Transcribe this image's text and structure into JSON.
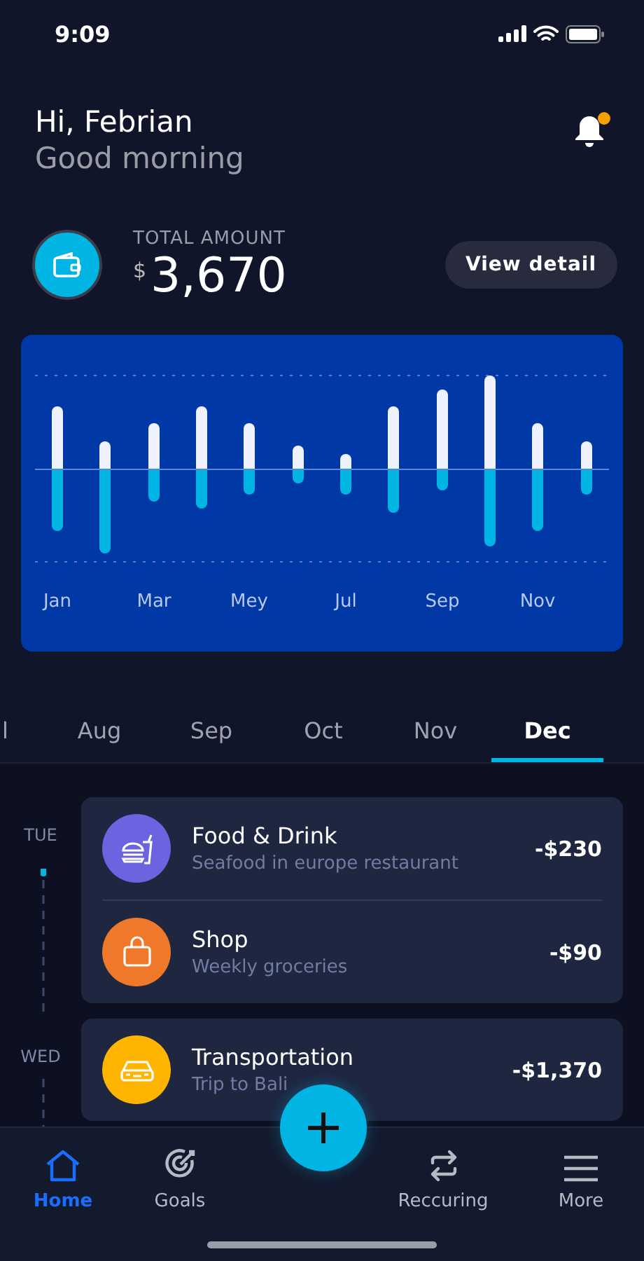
{
  "status_bar": {
    "time": "9:09"
  },
  "header": {
    "greeting": "Hi, Febrian",
    "subtitle": "Good morning",
    "notification_badge": true
  },
  "total": {
    "label": "TOTAL AMOUNT",
    "currency": "$",
    "amount": "3,670",
    "button": "View detail"
  },
  "chart": {
    "month_labels": [
      "Jan",
      "Mar",
      "Mey",
      "Jul",
      "Sep",
      "Nov"
    ]
  },
  "month_tabs": [
    {
      "label": "l",
      "selected": false
    },
    {
      "label": "Aug",
      "selected": false
    },
    {
      "label": "Sep",
      "selected": false
    },
    {
      "label": "Oct",
      "selected": false
    },
    {
      "label": "Nov",
      "selected": false
    },
    {
      "label": "Dec",
      "selected": true
    }
  ],
  "transaction_groups": [
    {
      "day": "TUE",
      "transactions": [
        {
          "kind": "food",
          "title": "Food & Drink",
          "note": "Seafood in europe restaurant",
          "amount": "-$230",
          "color": "#6c63e0"
        },
        {
          "kind": "shop",
          "title": "Shop",
          "note": "Weekly groceries",
          "amount": "-$90",
          "color": "#f0782a"
        }
      ]
    },
    {
      "day": "WED",
      "transactions": [
        {
          "kind": "transport",
          "title": "Transportation",
          "note": "Trip to Bali",
          "amount": "-$1,370",
          "color": "#ffb400"
        }
      ]
    }
  ],
  "bottom_nav": [
    {
      "kind": "home",
      "label": "Home",
      "selected": true
    },
    {
      "kind": "goals",
      "label": "Goals",
      "selected": false
    },
    {
      "kind": "recurring",
      "label": "Reccuring",
      "selected": false
    },
    {
      "kind": "more",
      "label": "More",
      "selected": false
    }
  ]
}
